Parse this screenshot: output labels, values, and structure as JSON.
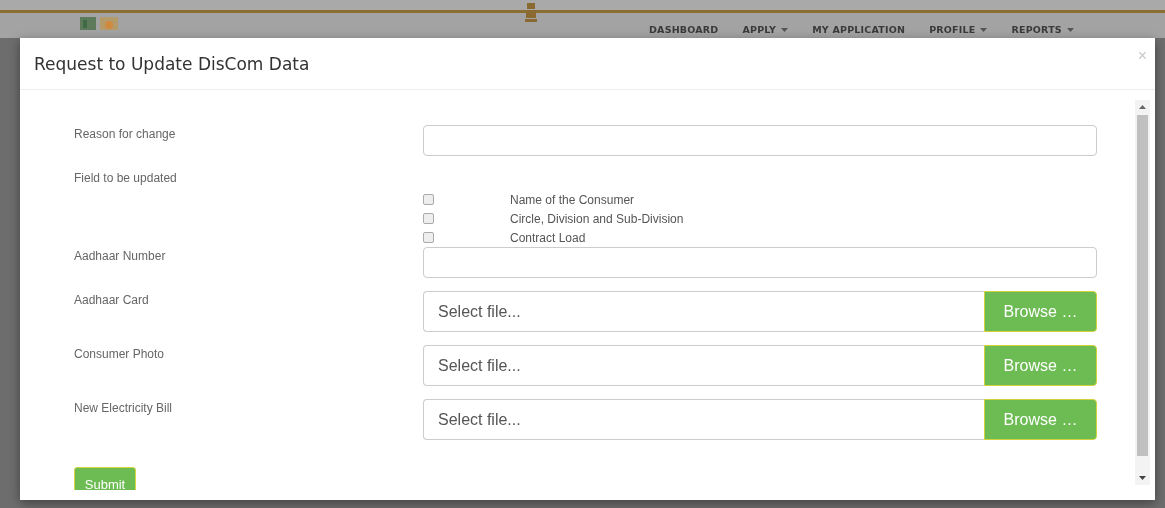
{
  "nav": {
    "items": [
      {
        "label": "DASHBOARD",
        "has_menu": false
      },
      {
        "label": "APPLY",
        "has_menu": true
      },
      {
        "label": "MY APPLICATION",
        "has_menu": false
      },
      {
        "label": "PROFILE",
        "has_menu": true
      },
      {
        "label": "REPORTS",
        "has_menu": true
      }
    ]
  },
  "modal": {
    "title": "Request to Update DisCom Data",
    "close": "×"
  },
  "form": {
    "rows": [
      {
        "kind": "text",
        "label": "Reason for change"
      },
      {
        "kind": "checkboxes",
        "label": "Field to be updated",
        "options": [
          {
            "label": "Name of the Consumer",
            "checked": false
          },
          {
            "label": "Circle, Division and Sub-Division",
            "checked": false
          },
          {
            "label": "Contract Load",
            "checked": false
          }
        ]
      },
      {
        "kind": "text",
        "label": "Aadhaar Number"
      },
      {
        "kind": "file",
        "label": "Aadhaar Card",
        "placeholder": "Select file...",
        "button": "Browse …"
      },
      {
        "kind": "file",
        "label": "Consumer Photo",
        "placeholder": "Select file...",
        "button": "Browse …"
      },
      {
        "kind": "file",
        "label": "New Electricity Bill",
        "placeholder": "Select file...",
        "button": "Browse …"
      }
    ],
    "submit": "Submit"
  }
}
